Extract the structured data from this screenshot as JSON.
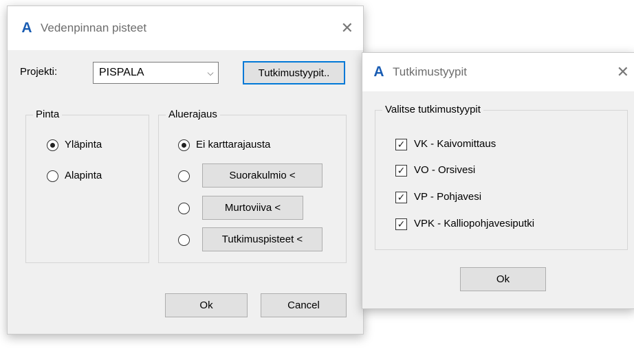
{
  "dialog_main": {
    "title": "Vedenpinnan pisteet",
    "project_label": "Projekti:",
    "project_value": "PISPALA",
    "tutkimustyypit_button": "Tutkimustyypit..",
    "pinta": {
      "label": "Pinta",
      "options": [
        "Yläpinta",
        "Alapinta"
      ],
      "selected": "Yläpinta"
    },
    "aluerajaus": {
      "label": "Aluerajaus",
      "option_no_limit": "Ei karttarajausta",
      "buttons": [
        "Suorakulmio <",
        "Murtoviiva <",
        "Tutkimuspisteet <"
      ],
      "selected": "Ei karttarajausta"
    },
    "ok_label": "Ok",
    "cancel_label": "Cancel"
  },
  "dialog_types": {
    "title": "Tutkimustyypit",
    "group_label": "Valitse tutkimustyypit",
    "items": [
      {
        "label": "VK - Kaivomittaus",
        "checked": true
      },
      {
        "label": "VO - Orsivesi",
        "checked": true
      },
      {
        "label": "VP - Pohjavesi",
        "checked": true
      },
      {
        "label": "VPK - Kalliopohjavesiputki",
        "checked": true
      }
    ],
    "ok_label": "Ok"
  },
  "icons": {
    "app": "autocad-a-icon",
    "close": "close-x-icon",
    "check_mark": "✓"
  },
  "colors": {
    "app_icon": "#1a5db3",
    "window_bg": "#f0f0f0",
    "default_button_border": "#0078d7"
  }
}
